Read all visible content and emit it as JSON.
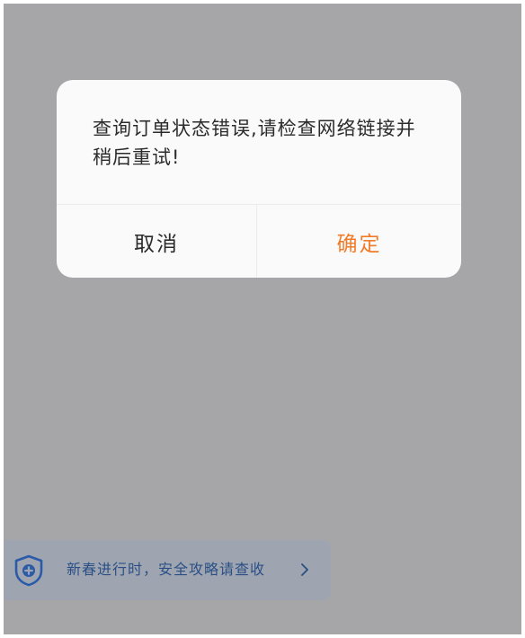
{
  "dialog": {
    "message": "查询订单状态错误,请检查网络链接并稍后重试!",
    "cancel_label": "取消",
    "confirm_label": "确定"
  },
  "banner": {
    "text": "新春进行时，安全攻略请查收",
    "icon": "shield-plus-icon",
    "chevron": "chevron-right-icon"
  },
  "colors": {
    "overlay": "#a6a6a8",
    "confirm_accent": "#f07c2a",
    "banner_text": "#2a4f86",
    "banner_icon": "#2a5aa8"
  }
}
